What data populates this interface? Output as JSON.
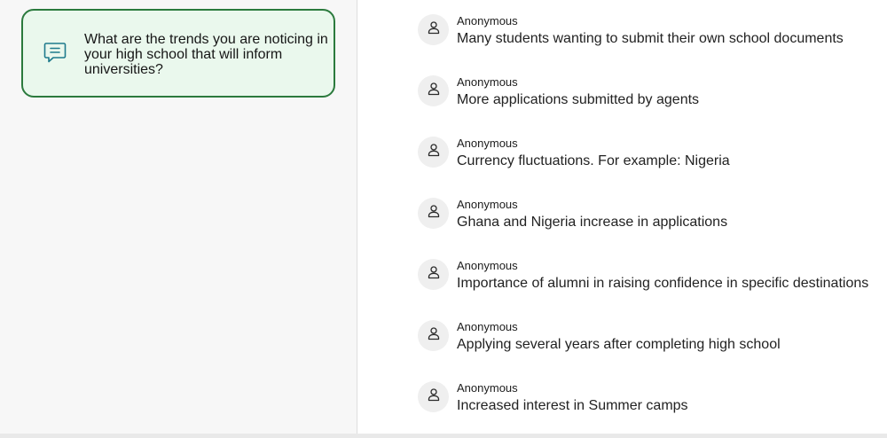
{
  "question": {
    "icon": "chat-lines-icon",
    "text": "What are the trends you are noticing in your high school that will inform universities?"
  },
  "colors": {
    "card_background": "#eaf8ed",
    "card_border": "#2b7a3d",
    "icon_accent": "#1e7a8c"
  },
  "responses": [
    {
      "author": "Anonymous",
      "avatar_icon": "user-icon",
      "text": "Many students wanting to submit their own school documents"
    },
    {
      "author": "Anonymous",
      "avatar_icon": "user-icon",
      "text": "More applications submitted by agents"
    },
    {
      "author": "Anonymous",
      "avatar_icon": "user-icon",
      "text": "Currency fluctuations. For example: Nigeria"
    },
    {
      "author": "Anonymous",
      "avatar_icon": "user-icon",
      "text": "Ghana and Nigeria increase in applications"
    },
    {
      "author": "Anonymous",
      "avatar_icon": "user-icon",
      "text": "Importance of alumni in raising confidence in specific destinations"
    },
    {
      "author": "Anonymous",
      "avatar_icon": "user-icon",
      "text": "Applying several years after completing high school"
    },
    {
      "author": "Anonymous",
      "avatar_icon": "user-icon",
      "text": "Increased interest in Summer camps"
    }
  ]
}
